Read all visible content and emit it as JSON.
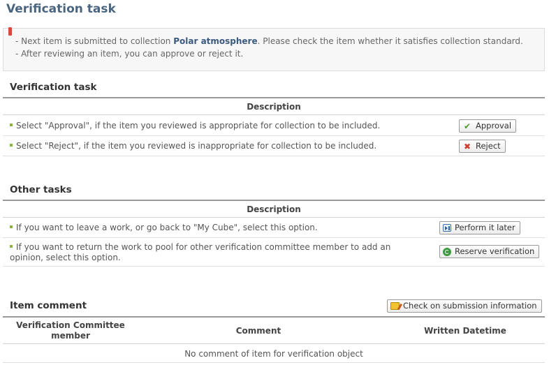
{
  "page": {
    "title": "Verification task"
  },
  "notice": {
    "line1_prefix": "- Next item is submitted to collection ",
    "collection": "Polar atmosphere",
    "line1_suffix": ". Please check the item whether it satisfies collection standard.",
    "line2": "- After reviewing an item, you can approve or reject it."
  },
  "verification": {
    "title": "Verification task",
    "header": "Description",
    "rows": [
      {
        "text": "Select \"Approval\", if the item you reviewed is appropriate for collection to be included.",
        "button": "Approval",
        "icon": "check-icon"
      },
      {
        "text": "Select \"Reject\", if the item you reviewed is inappropriate for collection to be included.",
        "button": "Reject",
        "icon": "x-icon"
      }
    ]
  },
  "other": {
    "title": "Other tasks",
    "header": "Description",
    "rows": [
      {
        "text": "If you want to leave a work, or go back to \"My Cube\", select this option.",
        "button": "Perform it later",
        "icon": "later-icon"
      },
      {
        "text": "If you want to return the work to pool for other verification committee member to add an opinion, select this option.",
        "button": "Reserve verification",
        "icon": "reserve-icon"
      }
    ]
  },
  "comment": {
    "title": "Item comment",
    "check_button": "Check on submission information",
    "columns": [
      "Verification Committee member",
      "Comment",
      "Written Datetime"
    ],
    "empty": "No comment of item for verification object"
  },
  "colors": {
    "title": "#4a6580",
    "highlight": "#3a5a82",
    "bullet": "#8db33f",
    "flag": "#d84a3a"
  }
}
